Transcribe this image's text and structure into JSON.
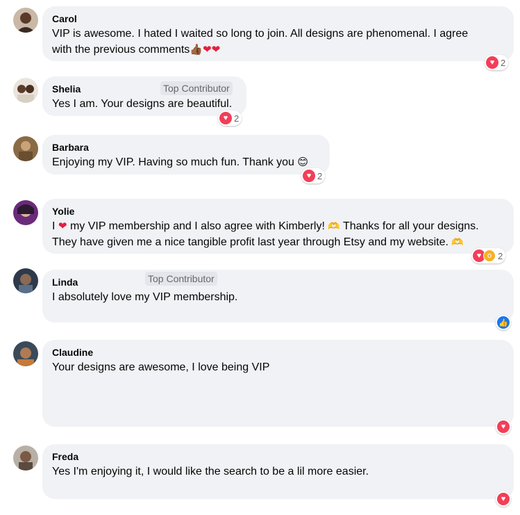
{
  "comments": [
    {
      "author": "Carol",
      "text_1": "VIP is awesome. I hated I waited so long to join. All designs are phenomenal. I agree",
      "text_2": "with the previous comments",
      "reaction_count": "2",
      "reaction_icons": [
        "heart-icon"
      ]
    },
    {
      "author": "Shelia",
      "badge": "Top Contributor",
      "text_1": "Yes I am. Your designs are beautiful.",
      "reaction_count": "2",
      "reaction_icons": [
        "heart-icon"
      ]
    },
    {
      "author": "Barbara",
      "text_1": "Enjoying my VIP. Having so much fun. Thank you",
      "reaction_count": "2",
      "reaction_icons": [
        "heart-icon"
      ]
    },
    {
      "author": "Yolie",
      "text_1a": "I",
      "text_1b": "my VIP membership and I also agree with Kimberly!",
      "text_1c": "Thanks for all your designs.",
      "text_2": "They have given me a nice tangible profit last year through Etsy and my website.",
      "reaction_count": "2",
      "reaction_icons": [
        "heart-icon",
        "wow-icon"
      ]
    },
    {
      "author": "Linda",
      "badge": "Top Contributor",
      "text_1": "I absolutely love my VIP membership.",
      "reaction_icons": [
        "like-icon"
      ]
    },
    {
      "author": "Claudine",
      "text_1": "Your designs are awesome, I love being VIP",
      "reaction_icons": [
        "heart-icon"
      ]
    },
    {
      "author": "Freda",
      "text_1": "Yes I'm enjoying it, I would like the search to be a lil more easier.",
      "reaction_icons": [
        "heart-icon"
      ]
    }
  ],
  "colors": {
    "bubble": "#f0f2f5",
    "heart": "#f33e58",
    "like": "#1877f2",
    "wow": "#f7b125"
  }
}
